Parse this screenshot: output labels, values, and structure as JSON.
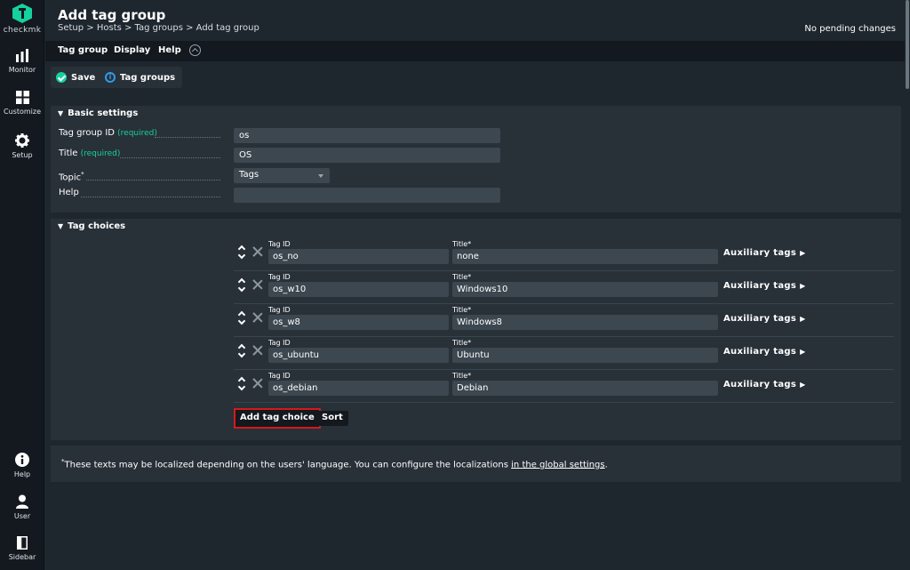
{
  "app": {
    "logo_text": "checkmk",
    "brand_color": "#15d1a0"
  },
  "sidebar": {
    "items": [
      {
        "label": "Monitor",
        "icon": "bar-chart-icon"
      },
      {
        "label": "Customize",
        "icon": "grid-icon"
      },
      {
        "label": "Setup",
        "icon": "gear-icon"
      },
      {
        "label": "Help",
        "icon": "info-icon"
      },
      {
        "label": "User",
        "icon": "user-icon"
      },
      {
        "label": "Sidebar",
        "icon": "sidebar-icon"
      }
    ]
  },
  "header": {
    "title": "Add tag group",
    "breadcrumb": "Setup > Hosts > Tag groups > Add tag group",
    "pending": "No pending changes"
  },
  "menu": {
    "items": [
      "Tag group",
      "Display",
      "Help"
    ]
  },
  "actions": {
    "save": "Save",
    "tag_groups": "Tag groups"
  },
  "basic": {
    "heading": "Basic settings",
    "id_label": "Tag group ID",
    "id_req": "(required)",
    "id_value": "os",
    "title_label": "Title",
    "title_req": "(required)",
    "title_value": "OS",
    "topic_label": "Topic",
    "topic_star": "*",
    "topic_value": "Tags",
    "help_label": "Help",
    "help_value": ""
  },
  "choices": {
    "heading": "Tag choices",
    "tag_id_label": "Tag ID",
    "title_label": "Title*",
    "aux_label": "Auxiliary tags",
    "rows": [
      {
        "id": "os_no",
        "title": "none"
      },
      {
        "id": "os_w10",
        "title": "Windows10"
      },
      {
        "id": "os_w8",
        "title": "Windows8"
      },
      {
        "id": "os_ubuntu",
        "title": "Ubuntu"
      },
      {
        "id": "os_debian",
        "title": "Debian"
      }
    ],
    "add_button": "Add tag choice",
    "sort_button": "Sort"
  },
  "footnote": {
    "star": "*",
    "text": "These texts may be localized depending on the users' language. You can configure the localizations ",
    "link": "in the global settings",
    "end": "."
  }
}
